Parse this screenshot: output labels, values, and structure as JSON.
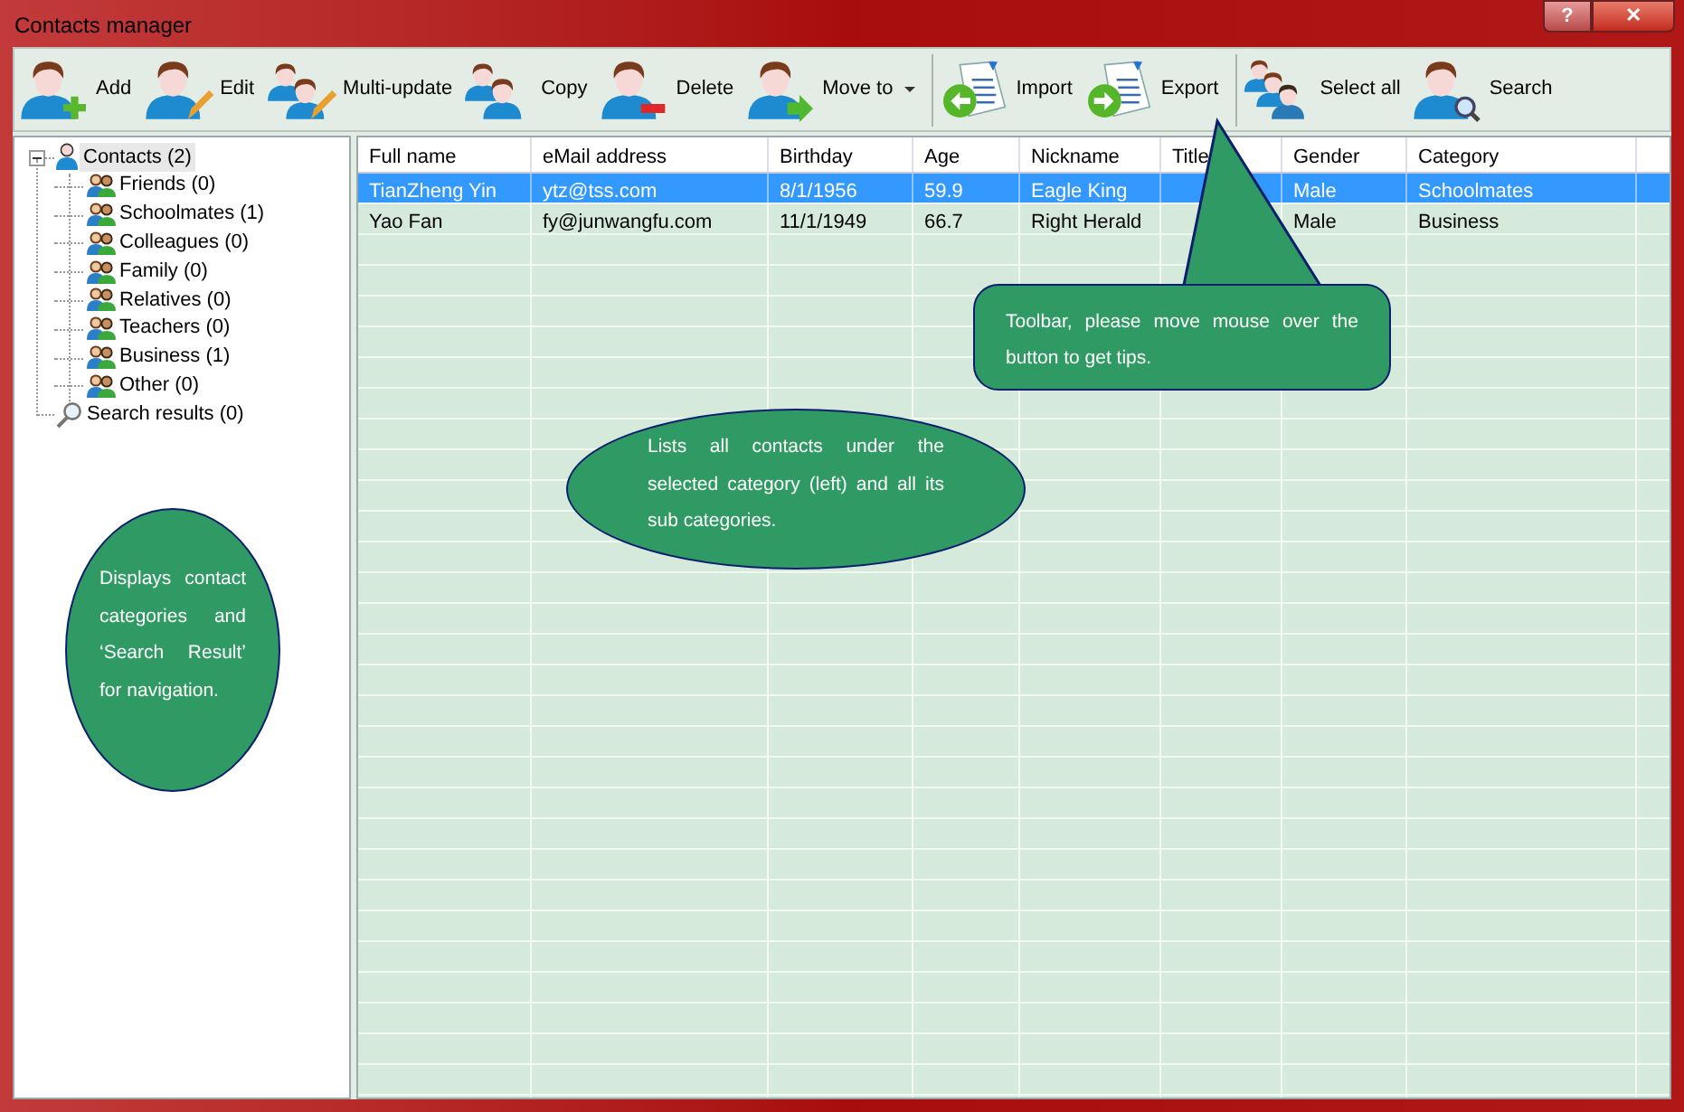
{
  "window": {
    "title": "Contacts manager",
    "controls": [
      {
        "kind": "help",
        "label": "?"
      },
      {
        "kind": "close",
        "label": "✕"
      }
    ]
  },
  "toolbar": [
    [
      {
        "kind": "add",
        "label": "Add"
      },
      {
        "kind": "edit",
        "label": "Edit"
      },
      {
        "kind": "multi",
        "label": "Multi-update"
      },
      {
        "kind": "copy",
        "label": "Copy"
      },
      {
        "kind": "delete",
        "label": "Delete"
      },
      {
        "kind": "move",
        "label": "Move to",
        "dropdown": true
      }
    ],
    [
      {
        "kind": "import",
        "label": "Import"
      },
      {
        "kind": "export",
        "label": "Export"
      }
    ],
    [
      {
        "kind": "selectall",
        "label": "Select all"
      },
      {
        "kind": "search",
        "label": "Search"
      }
    ]
  ],
  "tree": [
    {
      "kind": "root",
      "label": "Contacts (2)",
      "selected": true,
      "expanded": true,
      "children": [
        {
          "kind": "group",
          "label": "Friends (0)",
          "selected": false
        },
        {
          "kind": "group",
          "label": "Schoolmates (1)",
          "selected": false
        },
        {
          "kind": "group",
          "label": "Colleagues (0)",
          "selected": false
        },
        {
          "kind": "group",
          "label": "Family (0)",
          "selected": false
        },
        {
          "kind": "group",
          "label": "Relatives (0)",
          "selected": false
        },
        {
          "kind": "group",
          "label": "Teachers (0)",
          "selected": false
        },
        {
          "kind": "group",
          "label": "Business (1)",
          "selected": false
        },
        {
          "kind": "group",
          "label": "Other (0)",
          "selected": false
        }
      ]
    },
    {
      "kind": "search",
      "label": "Search results (0)",
      "selected": false
    }
  ],
  "table": {
    "columns": [
      "Full name",
      "eMail address",
      "Birthday",
      "Age",
      "Nickname",
      "Title",
      "Gender",
      "Category"
    ],
    "rows": [
      {
        "selected": true,
        "cells": [
          "TianZheng Yin",
          "ytz@tss.com",
          "8/1/1956",
          "59.9",
          "Eagle King",
          "",
          "Male",
          "Schoolmates"
        ]
      },
      {
        "selected": false,
        "cells": [
          "Yao Fan",
          "fy@junwangfu.com",
          "11/1/1949",
          "66.7",
          "Right Herald",
          "",
          "Male",
          "Business"
        ]
      }
    ]
  },
  "callouts": [
    {
      "kind": "rect",
      "text": "Toolbar, please move mouse over the button to get tips."
    },
    {
      "kind": "ellipse",
      "text": "Lists all contacts under the selected category (left) and all its sub categories."
    },
    {
      "kind": "ellipse",
      "text": "Displays contact categories and ‘Search Result’ for navigation."
    }
  ]
}
